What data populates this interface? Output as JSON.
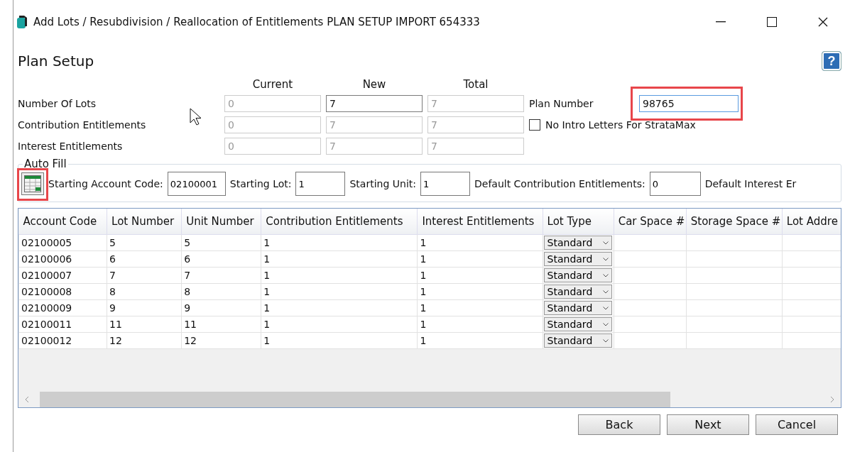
{
  "window": {
    "title": "Add Lots / Resubdivision / Reallocation of Entitlements PLAN SETUP IMPORT 654333"
  },
  "heading": "Plan Setup",
  "help": "?",
  "entitlements": {
    "columns": [
      "Current",
      "New",
      "Total"
    ],
    "rows": [
      {
        "label": "Number Of Lots",
        "values": [
          {
            "value": "0",
            "disabled": true
          },
          {
            "value": "7",
            "disabled": false
          },
          {
            "value": "7",
            "disabled": true
          }
        ]
      },
      {
        "label": "Contribution Entitlements",
        "values": [
          {
            "value": "0",
            "disabled": true
          },
          {
            "value": "7",
            "disabled": true
          },
          {
            "value": "7",
            "disabled": true
          }
        ]
      },
      {
        "label": "Interest Entitlements",
        "values": [
          {
            "value": "0",
            "disabled": true
          },
          {
            "value": "7",
            "disabled": true
          },
          {
            "value": "7",
            "disabled": true
          }
        ]
      }
    ]
  },
  "plan_number": {
    "label": "Plan Number",
    "value": "98765",
    "highlighted": true
  },
  "no_intro_letters": {
    "label": "No Intro Letters For StrataMax",
    "checked": false
  },
  "auto_fill": {
    "legend": "Auto Fill",
    "button_highlighted": true,
    "fields": [
      {
        "label": "Starting Account Code:",
        "value": "02100001"
      },
      {
        "label": "Starting Lot:",
        "value": "1"
      },
      {
        "label": "Starting Unit:",
        "value": "1"
      },
      {
        "label": "Default Contribution Entitlements:",
        "value": "0"
      },
      {
        "label": "Default Interest Er"
      }
    ]
  },
  "table": {
    "columns": [
      "Account Code",
      "Lot Number",
      "Unit Number",
      "Contribution Entitlements",
      "Interest Entitlements",
      "Lot Type",
      "Car Space #",
      "Storage Space #",
      "Lot Addre"
    ],
    "rows": [
      {
        "account_code": "02100005",
        "lot_number": "5",
        "unit_number": "5",
        "contribution": "1",
        "interest": "1",
        "lot_type": "Standard"
      },
      {
        "account_code": "02100006",
        "lot_number": "6",
        "unit_number": "6",
        "contribution": "1",
        "interest": "1",
        "lot_type": "Standard"
      },
      {
        "account_code": "02100007",
        "lot_number": "7",
        "unit_number": "7",
        "contribution": "1",
        "interest": "1",
        "lot_type": "Standard"
      },
      {
        "account_code": "02100008",
        "lot_number": "8",
        "unit_number": "8",
        "contribution": "1",
        "interest": "1",
        "lot_type": "Standard"
      },
      {
        "account_code": "02100009",
        "lot_number": "9",
        "unit_number": "9",
        "contribution": "1",
        "interest": "1",
        "lot_type": "Standard"
      },
      {
        "account_code": "02100011",
        "lot_number": "11",
        "unit_number": "11",
        "contribution": "1",
        "interest": "1",
        "lot_type": "Standard"
      },
      {
        "account_code": "02100012",
        "lot_number": "12",
        "unit_number": "12",
        "contribution": "1",
        "interest": "1",
        "lot_type": "Standard"
      }
    ]
  },
  "buttons": [
    "Back",
    "Next",
    "Cancel"
  ]
}
